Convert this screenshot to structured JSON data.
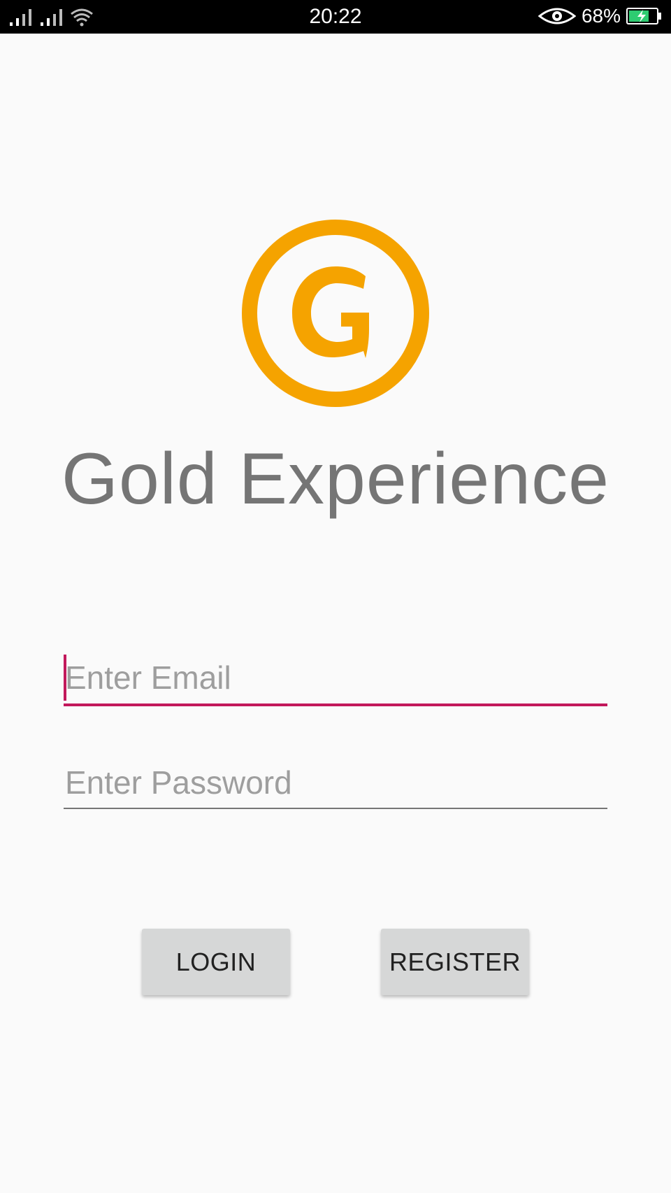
{
  "status_bar": {
    "time": "20:22",
    "battery_text": "68%",
    "icons": [
      "signal-icon",
      "signal-icon",
      "wifi-icon",
      "eye-icon",
      "battery-charging-icon"
    ]
  },
  "app": {
    "logo_letter": "G",
    "title": "Gold Experience",
    "accent_color": "#F5A300",
    "focus_color": "#C2185B"
  },
  "form": {
    "email_placeholder": "Enter Email",
    "email_value": "",
    "password_placeholder": "Enter Password",
    "password_value": ""
  },
  "buttons": {
    "login_label": "LOGIN",
    "register_label": "REGISTER"
  }
}
